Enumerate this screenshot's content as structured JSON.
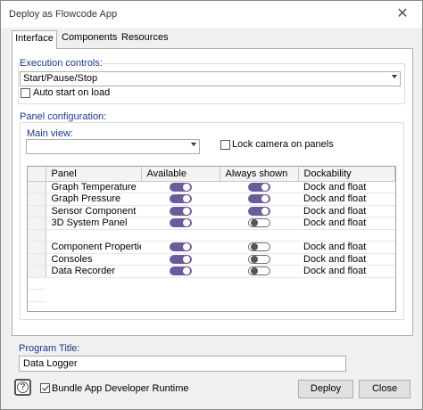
{
  "window": {
    "title": "Deploy as Flowcode App",
    "close_glyph": "✕"
  },
  "tabs": [
    {
      "label": "Interface",
      "active": true
    },
    {
      "label": "Components",
      "active": false
    },
    {
      "label": "Resources",
      "active": false
    }
  ],
  "execution": {
    "group_label": "Execution controls:",
    "selected": "Start/Pause/Stop",
    "autostart_label": "Auto start on load",
    "autostart_checked": false
  },
  "panel_config": {
    "group_label": "Panel configuration:",
    "main_view_label": "Main view:",
    "main_view_value": "",
    "lock_camera_label": "Lock camera on panels",
    "lock_camera_checked": false,
    "columns": [
      "Panel",
      "Available",
      "Always shown",
      "Dockability"
    ],
    "rows": [
      {
        "name": "Graph Temperature",
        "available": true,
        "always_shown": true,
        "dockability": "Dock and float"
      },
      {
        "name": "Graph Pressure",
        "available": true,
        "always_shown": true,
        "dockability": "Dock and float"
      },
      {
        "name": "Sensor Component",
        "available": true,
        "always_shown": true,
        "dockability": "Dock and float"
      },
      {
        "name": "3D System Panel",
        "available": true,
        "always_shown": false,
        "dockability": "Dock and float"
      },
      {
        "name": "",
        "available": null,
        "always_shown": null,
        "dockability": ""
      },
      {
        "name": "Component Properties",
        "available": true,
        "always_shown": false,
        "dockability": "Dock and float"
      },
      {
        "name": "Consoles",
        "available": true,
        "always_shown": false,
        "dockability": "Dock and float"
      },
      {
        "name": "Data Recorder",
        "available": true,
        "always_shown": false,
        "dockability": "Dock and float"
      }
    ]
  },
  "program_title": {
    "label": "Program Title:",
    "value": "Data Logger"
  },
  "footer": {
    "help_icon": "help-icon",
    "help_glyph": "?",
    "bundle_label": "Bundle App Developer Runtime",
    "bundle_checked": true,
    "deploy_label": "Deploy",
    "close_label": "Close"
  },
  "colors": {
    "toggle_on": "#6b5b9a",
    "group_label": "#1a3a8c"
  }
}
